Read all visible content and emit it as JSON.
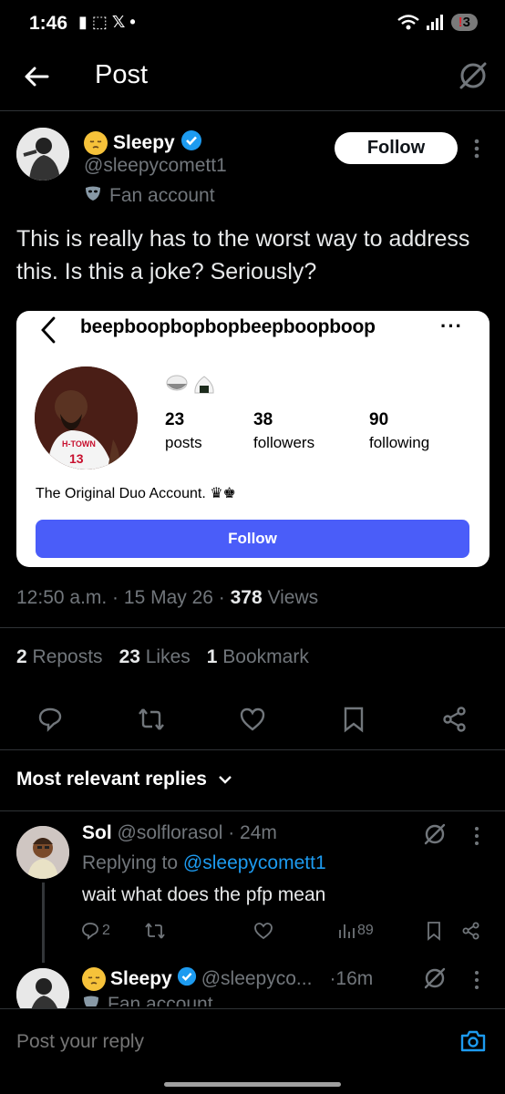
{
  "status_bar": {
    "time": "1:46",
    "left_icons": "▮ ⬚ 𝕏 •",
    "battery": "3",
    "battery_alert": "!"
  },
  "header": {
    "title": "Post"
  },
  "post": {
    "author_name": "Sleepy",
    "author_handle": "@sleepycomett1",
    "author_label": "Fan account",
    "follow_label": "Follow",
    "text": "This is really has to the worst way to address this. Is this a joke? Seriously?",
    "timestamp": "12:50 a.m. · 15 May 26 · ",
    "views_count": "378",
    "views_label": " Views",
    "reposts_count": "2",
    "reposts_label": " Reposts",
    "likes_count": "23",
    "likes_label": " Likes",
    "bookmarks_count": "1",
    "bookmarks_label": " Bookmark"
  },
  "embed": {
    "username": "beepboopbopbopbeepboopboop",
    "more": "···",
    "avatar_jersey_text": "H-TOWN",
    "avatar_jersey_number": "13",
    "posts_count": "23",
    "posts_label": "posts",
    "followers_count": "38",
    "followers_label": "followers",
    "following_count": "90",
    "following_label": "following",
    "bio": "The Original Duo Account. ♛♚",
    "follow_label": "Follow"
  },
  "replies": {
    "header": "Most relevant replies",
    "items": [
      {
        "name": "Sol",
        "handle": " @solflorasol · 24m",
        "replying_prefix": "Replying to ",
        "replying_handle": "@sleepycomett1",
        "text": "wait what does the pfp mean",
        "replies": "2",
        "views": "89"
      },
      {
        "name": "Sleepy",
        "handle": "@sleepyco...",
        "time": "·16m",
        "label": "Fan account"
      }
    ]
  },
  "composer": {
    "placeholder": "Post your reply"
  },
  "colors": {
    "background": "#000000",
    "accent": "#1d9bf0",
    "ig_follow": "#4a5df9",
    "muted": "#71767b"
  }
}
